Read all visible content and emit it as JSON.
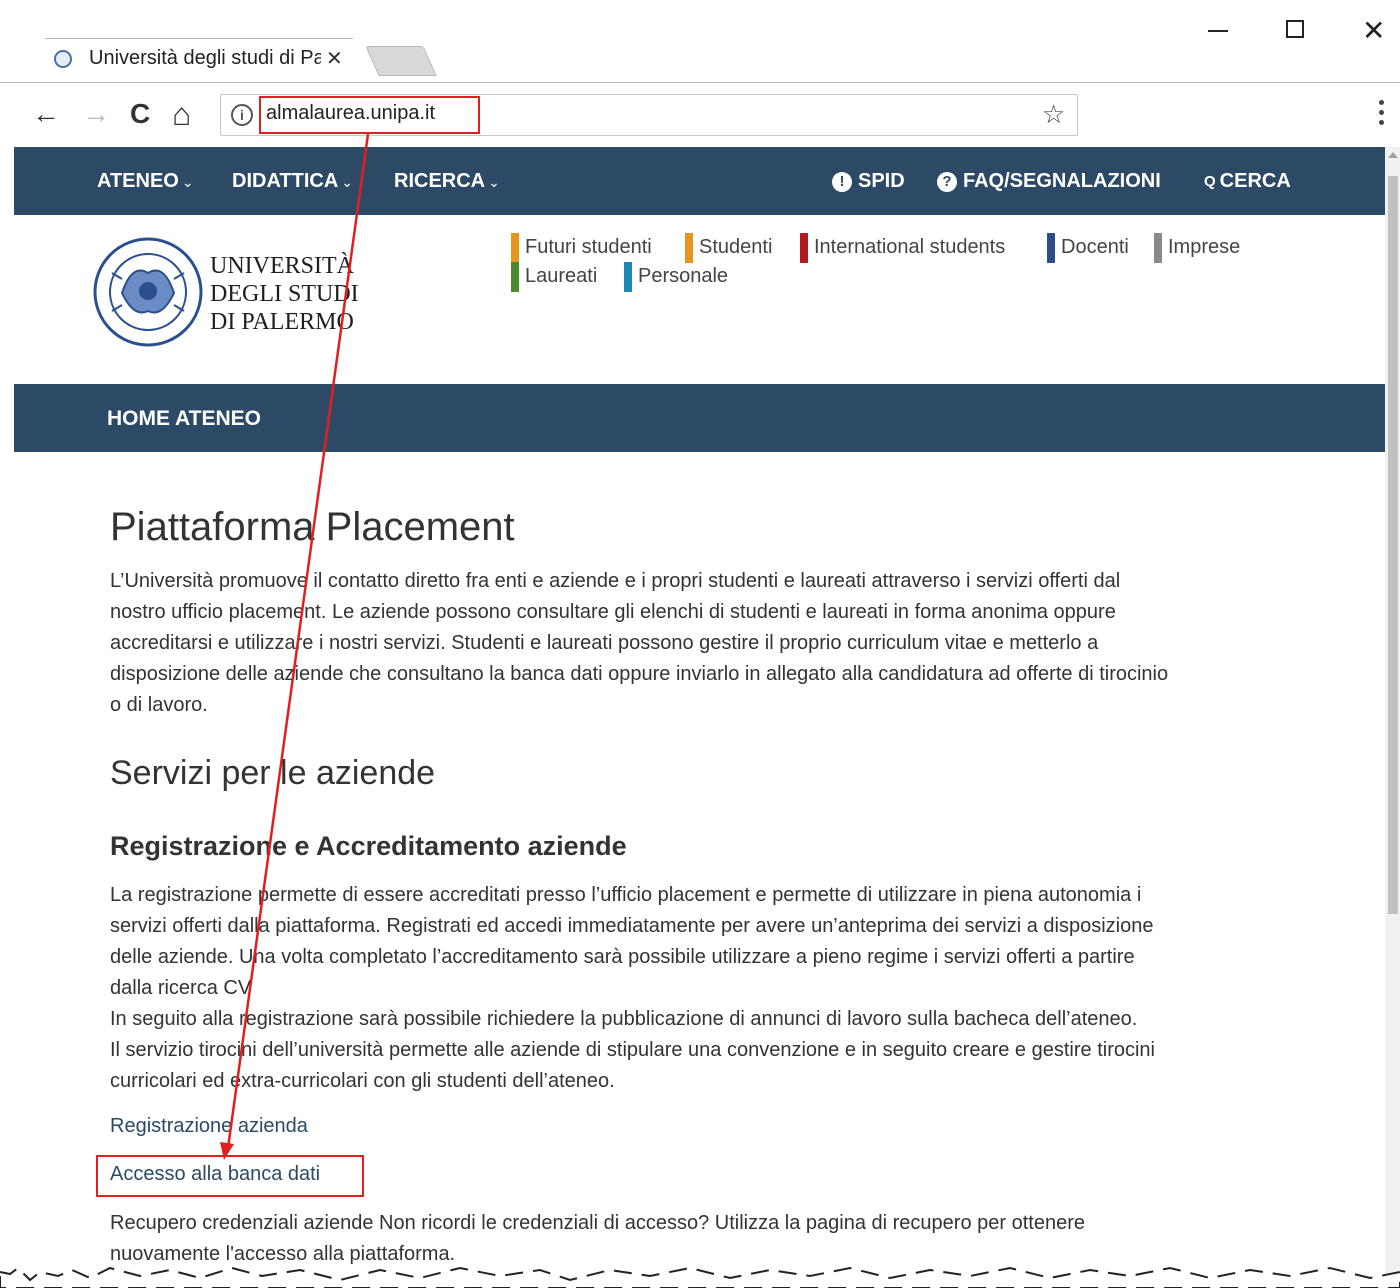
{
  "browser": {
    "tab_title": "Università degli studi di Palermo",
    "tab_close": "✕",
    "url": "almalaurea.unipa.it",
    "nav": {
      "back": "←",
      "forward": "→",
      "reload": "C",
      "home": "⌂"
    },
    "info_icon": "i",
    "star": "☆",
    "window_close": "✕"
  },
  "topnav": {
    "items": [
      "ATENEO",
      "DIDATTICA",
      "RICERCA"
    ],
    "chevron": "⌄",
    "right": [
      {
        "icon": "!",
        "label": "SPID"
      },
      {
        "icon": "?",
        "label": "FAQ/SEGNALAZIONI"
      },
      {
        "icon": "Q",
        "label": "CERCA"
      }
    ]
  },
  "logo": {
    "lines": [
      "UNIVERSITÀ",
      "DEGLI STUDI",
      "DI PALERMO"
    ]
  },
  "audience": [
    {
      "label": "Futuri studenti",
      "color": "#e8951e"
    },
    {
      "label": "Studenti",
      "color": "#e8951e"
    },
    {
      "label": "International students",
      "color": "#b3181d"
    },
    {
      "label": "Docenti",
      "color": "#2e4b8a"
    },
    {
      "label": "Imprese",
      "color": "#8a8a8a"
    },
    {
      "label": "Laureati",
      "color": "#4f8a2e"
    },
    {
      "label": "Personale",
      "color": "#1f87b5"
    }
  ],
  "secnav": {
    "home": "HOME ATENEO"
  },
  "main": {
    "title": "Piattaforma Placement",
    "intro_lines": [
      "L’Università promuove il contatto diretto fra enti e aziende e i propri studenti e laureati attraverso i servizi offerti dal",
      "nostro ufficio placement. Le aziende possono consultare gli elenchi di studenti e laureati in forma anonima oppure",
      "accreditarsi e utilizzare i nostri servizi. Studenti e laureati possono gestire il proprio curriculum vitae e metterlo a",
      "disposizione delle aziende che consultano la banca dati oppure inviarlo in allegato alla candidatura ad offerte di tirocinio",
      "o di lavoro."
    ],
    "section_title": "Servizi per le aziende",
    "subsection_title": "Registrazione e Accreditamento aziende",
    "body_lines": [
      "La registrazione permette di essere accreditati presso l’ufficio placement e permette di utilizzare in piena autonomia i",
      "servizi offerti dalla piattaforma. Registrati ed accedi immediatamente per avere un’anteprima dei servizi a disposizione",
      "delle aziende. Una volta completato l’accreditamento sarà possibile utilizzare a pieno regime i servizi offerti a partire",
      "dalla ricerca CV",
      "In seguito alla registrazione sarà possibile richiedere la pubblicazione di annunci di lavoro sulla bacheca dell’ateneo.",
      "Il servizio tirocini dell’università permette alle aziende di stipulare una convenzione e in seguito creare e gestire tirocini",
      "curricolari ed extra-curricolari con gli studenti dell’ateneo."
    ],
    "link_register": "Registrazione azienda",
    "link_access": "Accesso alla banca dati",
    "recovery_lines": [
      "Recupero credenziali aziende Non ricordi le credenziali di accesso? Utilizza la pagina di recupero per ottenere",
      "nuovamente l'accesso alla piattaforma."
    ]
  }
}
